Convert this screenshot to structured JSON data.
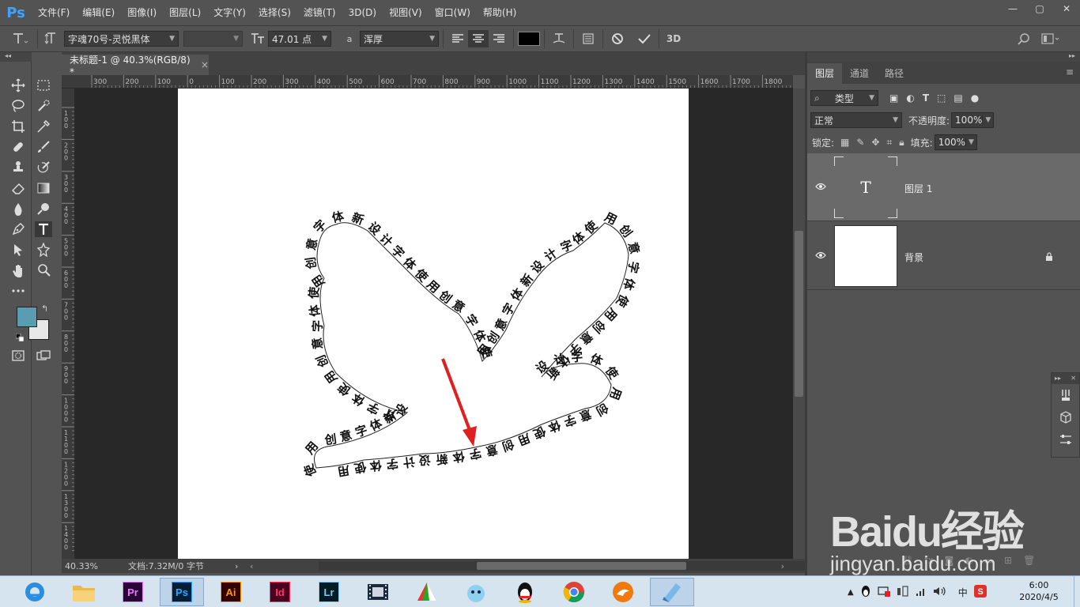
{
  "app": {
    "logo": "Ps"
  },
  "menu": [
    "文件(F)",
    "编辑(E)",
    "图像(I)",
    "图层(L)",
    "文字(Y)",
    "选择(S)",
    "滤镜(T)",
    "3D(D)",
    "视图(V)",
    "窗口(W)",
    "帮助(H)"
  ],
  "window_controls": {
    "minimize": "—",
    "restore": "▢",
    "close": "✕"
  },
  "options": {
    "font_family": "字魂70号-灵悦黑体",
    "font_style": "",
    "font_size": "47.01 点",
    "aa_prefix": "a",
    "antialias": "浑厚",
    "mode_3d": "3D"
  },
  "document": {
    "tab_title": "未标题-1 @ 40.3%(RGB/8) *",
    "close": "×",
    "zoom": "40.33%",
    "doc_info": "文档:7.32M/0 字节",
    "ruler_h": [
      "300",
      "200",
      "100",
      "0",
      "100",
      "200",
      "300",
      "400",
      "500",
      "600",
      "700",
      "800",
      "900",
      "1000",
      "1100",
      "1200",
      "1300",
      "1400",
      "1500",
      "1600",
      "1700",
      "1800",
      "19"
    ],
    "ruler_v": [
      "1\n0\n0",
      "2\n0\n0",
      "3\n0\n0",
      "4\n0\n0",
      "5\n0\n0",
      "6\n0\n0",
      "7\n0\n0",
      "8\n0\n0",
      "9\n0\n0",
      "1\n0\n0\n0",
      "1\n1\n0\n0",
      "1\n2\n0\n0",
      "1\n3\n0\n0",
      "1\n4\n0\n0"
    ],
    "path_glyphs": "使用创意字体新设计字体使用创意字体",
    "arrow_color": "#e02020"
  },
  "layers_panel": {
    "tabs": [
      "图层",
      "通道",
      "路径"
    ],
    "filter_label": "类型",
    "blend_mode": "正常",
    "opacity_label": "不透明度:",
    "opacity_value": "100%",
    "lock_label": "锁定:",
    "fill_label": "填充:",
    "fill_value": "100%",
    "layers": [
      {
        "name": "图层 1",
        "thumb": "T",
        "selected": true
      },
      {
        "name": "背景",
        "selected": false,
        "locked": true
      }
    ]
  },
  "colors": {
    "foreground": "#5a9db0",
    "background": "#e8e8e8",
    "ps_blue": "#3fa2ff",
    "panel_bg": "#535353"
  },
  "taskbar": {
    "apps": [
      {
        "name": "browser",
        "label": ""
      },
      {
        "name": "explorer",
        "label": ""
      },
      {
        "name": "premiere",
        "label": "Pr",
        "color": "#ea77ff",
        "bg": "#2a0634"
      },
      {
        "name": "photoshop",
        "label": "Ps",
        "color": "#31a8ff",
        "bg": "#001e36"
      },
      {
        "name": "illustrator",
        "label": "Ai",
        "color": "#ff9a00",
        "bg": "#330000"
      },
      {
        "name": "indesign",
        "label": "Id",
        "color": "#ff3366",
        "bg": "#49021f"
      },
      {
        "name": "lightroom",
        "label": "Lr",
        "color": "#7fc8f7",
        "bg": "#001d26"
      },
      {
        "name": "video",
        "label": ""
      },
      {
        "name": "app-a",
        "label": ""
      },
      {
        "name": "app-b",
        "label": ""
      },
      {
        "name": "qq",
        "label": ""
      },
      {
        "name": "chrome",
        "label": ""
      },
      {
        "name": "app-c",
        "label": ""
      },
      {
        "name": "app-d",
        "label": ""
      }
    ],
    "ime": "中",
    "time": "6:00",
    "date": "2020/4/5"
  },
  "watermark": {
    "brand": "Baidu经验",
    "url": "jingyan.baidu.com"
  }
}
